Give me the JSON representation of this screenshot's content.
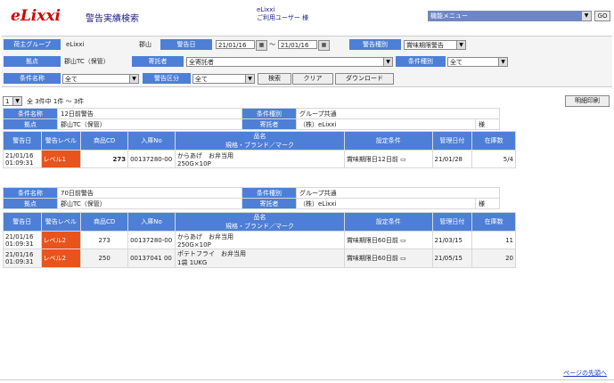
{
  "header": {
    "logo": "eLixxi",
    "page_title": "警告実績検索",
    "user_company": "eLixxi",
    "user_name": "ご利用ユーザー 様",
    "menu_select": "機能メニュー",
    "go_label": "GO"
  },
  "filters": {
    "shipper_group_label": "荷主グループ",
    "shipper_group_value": "eLixxi",
    "shipper_group_sub": "郡山",
    "warning_date_label": "警告日",
    "date_from": "21/01/16",
    "date_sep": "～",
    "date_to": "21/01/16",
    "warning_type_label": "警告種別",
    "warning_type_value": "賞味期限警告",
    "base_label": "拠点",
    "base_value": "郡山TC（保管）",
    "consignor_label": "寄託者",
    "consignor_value": "全寄託者",
    "cond_type_label": "条件種別",
    "cond_type_value": "全て",
    "cond_name_label": "条件名称",
    "cond_name_value": "全て",
    "warn_class_label": "警告区分",
    "warn_class_value": "全て",
    "search_btn": "検索",
    "clear_btn": "クリア",
    "download_btn": "ダウンロード"
  },
  "pager": {
    "page_value": "1",
    "summary": "全 3件中 1件 ～ 3件",
    "print_btn": "明細印刷"
  },
  "groups": [
    {
      "cond_name_label": "条件名称",
      "cond_name": "12日前警告",
      "cond_type_label": "条件種別",
      "cond_type": "グループ共通",
      "base_label": "拠点",
      "base": "郡山TC（保管）",
      "consignor_label": "寄託者",
      "consignor": "（株）eLixxi",
      "sama": "様",
      "rows": [
        {
          "date": "21/01/16",
          "time": "01:09:31",
          "level": "レベル1",
          "code": "273",
          "no": "00137280-00",
          "name1": "からあげ　お弁当用",
          "name2": "250G×10P",
          "cond": "賞味期限日12日前",
          "mdate": "21/01/28",
          "stock": "5/4"
        }
      ]
    },
    {
      "cond_name_label": "条件名称",
      "cond_name": "70日前警告",
      "cond_type_label": "条件種別",
      "cond_type": "グループ共通",
      "base_label": "拠点",
      "base": "郡山TC（保管）",
      "consignor_label": "寄託者",
      "consignor": "（株）eLixxi",
      "sama": "様",
      "rows": [
        {
          "date": "21/01/16",
          "time": "01:09:31",
          "level": "レベル2",
          "code": "273",
          "no": "00137280-00",
          "name1": "からあげ　お弁当用",
          "name2": "250G×10P",
          "cond": "賞味期限日60日前",
          "mdate": "21/03/15",
          "stock": "11"
        },
        {
          "date": "21/01/16",
          "time": "01:09:31",
          "level": "レベル2",
          "code": "250",
          "no": "00137041 00",
          "name1": "ポテトフライ　お弁当用",
          "name2": "1袋 1UKG",
          "cond": "賞味期限日60日前",
          "mdate": "21/05/15",
          "stock": "20"
        }
      ]
    }
  ],
  "columns": {
    "date": "警告日",
    "level": "警告レベル",
    "code": "商品CD",
    "no": "入庫No",
    "name_a": "品名",
    "name_b": "規格・ブランド／マーク",
    "cond": "設定条件",
    "mdate": "管理日付",
    "stock": "在庫数"
  },
  "footer": {
    "to_top": "ページの先頭へ"
  },
  "colors": {
    "header_blue": "#4d7fd6",
    "level_orange": "#e8541c",
    "logo_red": "#d40000"
  }
}
